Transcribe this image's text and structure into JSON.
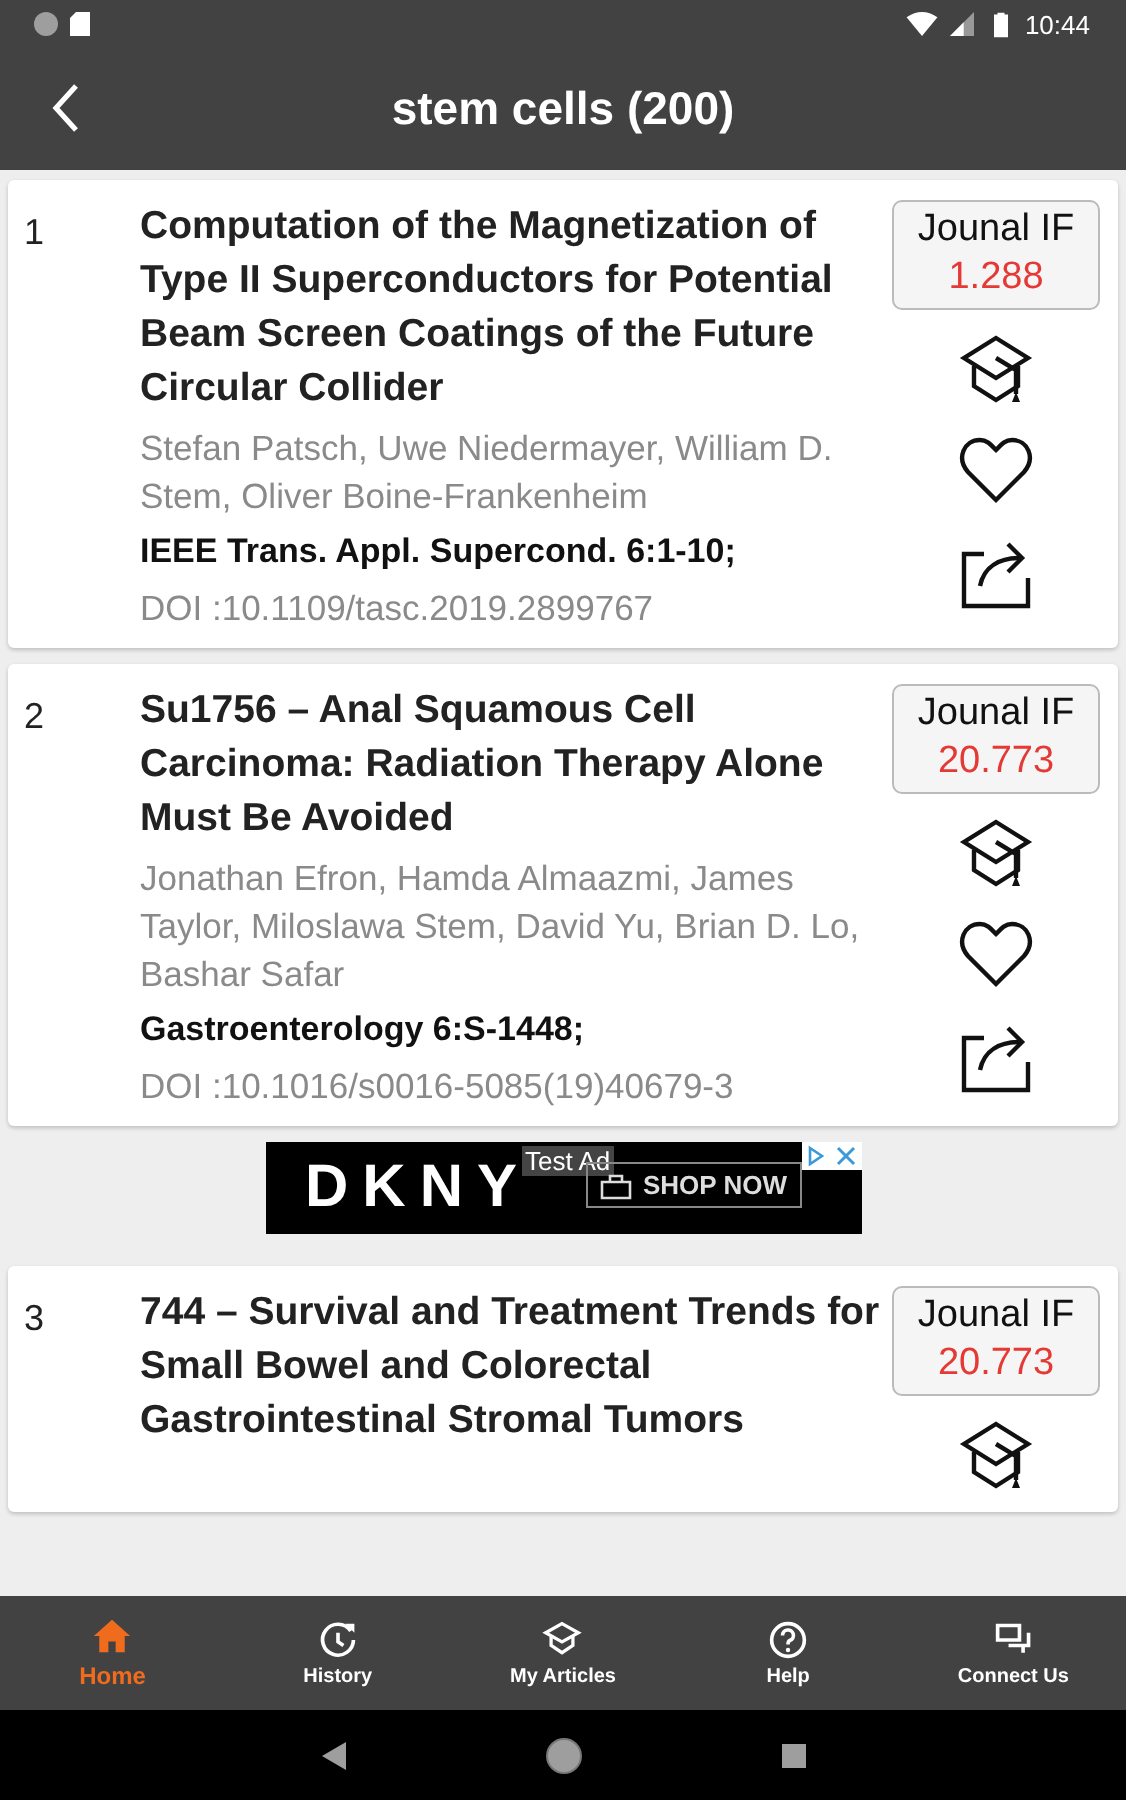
{
  "status_bar": {
    "time": "10:44"
  },
  "header": {
    "title": "stem cells (200)"
  },
  "articles": [
    {
      "number": "1",
      "title": "Computation of the Magnetization of Type II Superconductors for Potential Beam Screen Coatings of the Future Circular Collider",
      "authors": "Stefan Patsch, Uwe Niedermayer, William D. Stem, Oliver Boine-Frankenheim",
      "journal": "IEEE Trans. Appl. Supercond. 6:1-10;",
      "doi": "DOI :10.1109/tasc.2019.2899767",
      "if_label": "Jounal IF",
      "if_value": "1.288",
      "favorite": false
    },
    {
      "number": "2",
      "title": "Su1756 – Anal Squamous Cell Carcinoma: Radiation Therapy Alone Must Be Avoided",
      "authors": "Jonathan Efron, Hamda Almaazmi, James Taylor, Miloslawa Stem, David Yu, Brian D. Lo, Bashar Safar",
      "journal": "Gastroenterology 6:S-1448;",
      "doi": "DOI :10.1016/s0016-5085(19)40679-3",
      "if_label": "Jounal IF",
      "if_value": "20.773",
      "favorite": false
    },
    {
      "number": "3",
      "title": "744 – Survival and Treatment Trends for Small Bowel and Colorectal Gastrointestinal Stromal Tumors",
      "if_label": "Jounal IF",
      "if_value": "20.773"
    }
  ],
  "ad": {
    "brand": "DKNY",
    "tag": "Test Ad",
    "cta": "SHOP NOW"
  },
  "bottom_nav": [
    {
      "label": "Home",
      "selected": true
    },
    {
      "label": "History",
      "selected": false
    },
    {
      "label": "My Articles",
      "selected": false
    },
    {
      "label": "Help",
      "selected": false
    },
    {
      "label": "Connect Us",
      "selected": false
    }
  ]
}
